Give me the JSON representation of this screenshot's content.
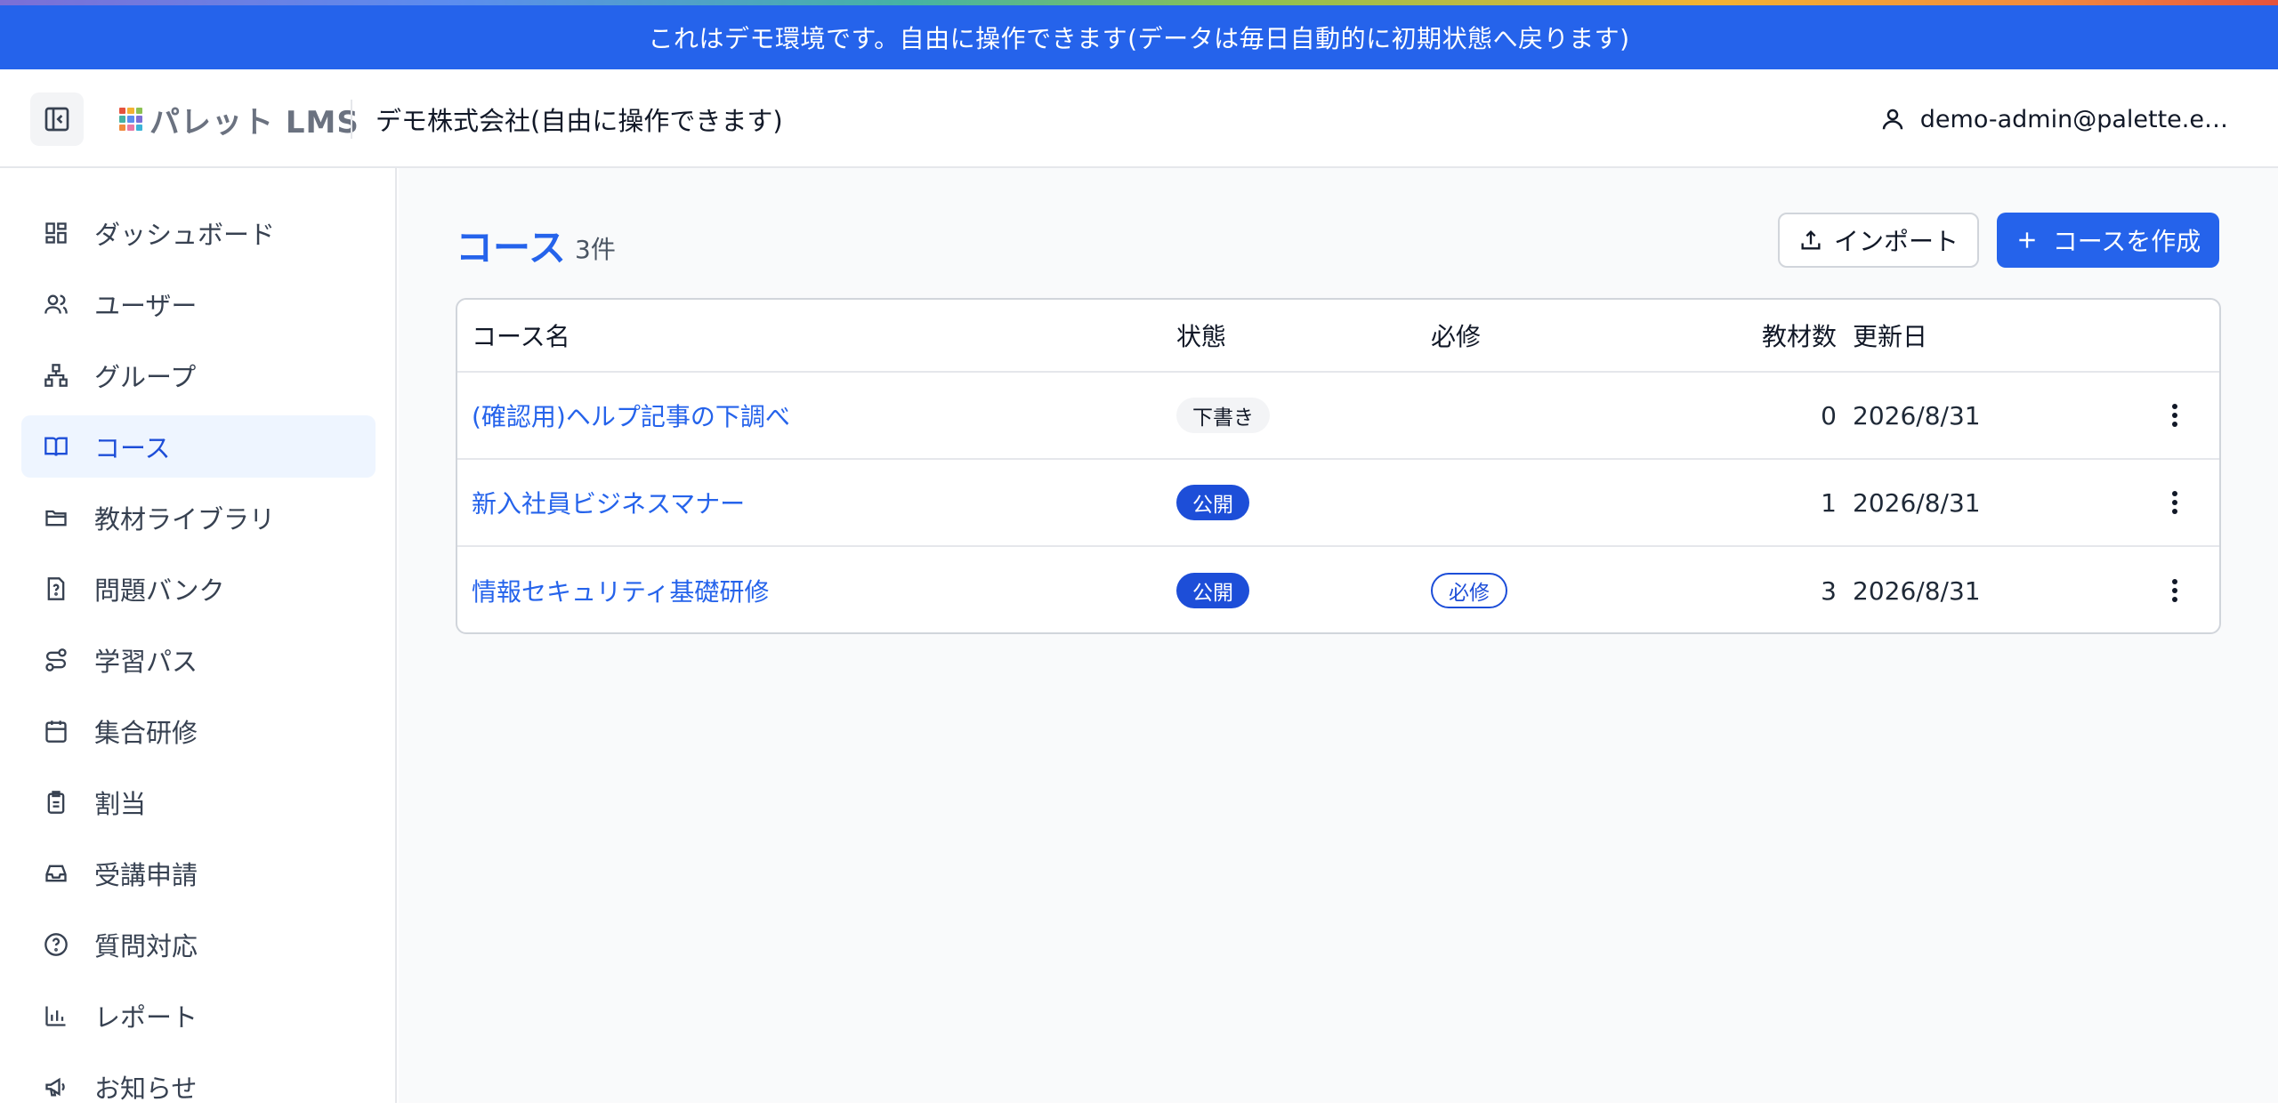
{
  "banner": {
    "text": "これはデモ環境です。自由に操作できます(データは毎日自動的に初期状態へ戻ります)"
  },
  "header": {
    "logo_text": "パレット LMS",
    "company": "デモ株式会社(自由に操作できます)",
    "user_email": "demo-admin@palette.e…"
  },
  "sidebar": {
    "items": [
      {
        "label": "ダッシュボード",
        "icon": "dashboard-icon"
      },
      {
        "label": "ユーザー",
        "icon": "users-icon"
      },
      {
        "label": "グループ",
        "icon": "group-icon"
      },
      {
        "label": "コース",
        "icon": "book-icon",
        "active": true
      },
      {
        "label": "教材ライブラリ",
        "icon": "folder-icon"
      },
      {
        "label": "問題バンク",
        "icon": "question-file-icon"
      },
      {
        "label": "学習パス",
        "icon": "route-icon"
      },
      {
        "label": "集合研修",
        "icon": "calendar-icon"
      },
      {
        "label": "割当",
        "icon": "clipboard-icon"
      },
      {
        "label": "受講申請",
        "icon": "inbox-icon"
      },
      {
        "label": "質問対応",
        "icon": "help-circle-icon"
      },
      {
        "label": "レポート",
        "icon": "bar-chart-icon"
      },
      {
        "label": "お知らせ",
        "icon": "megaphone-icon"
      }
    ]
  },
  "main": {
    "title": "コース",
    "count": "3件",
    "import_label": "インポート",
    "create_label": "コースを作成",
    "table": {
      "headers": {
        "name": "コース名",
        "status": "状態",
        "required": "必修",
        "materials": "教材数",
        "updated": "更新日"
      },
      "rows": [
        {
          "name": "(確認用)ヘルプ記事の下調べ",
          "status": "下書き",
          "status_type": "draft",
          "required": "",
          "materials": "0",
          "updated": "2026/8/31"
        },
        {
          "name": "新入社員ビジネスマナー",
          "status": "公開",
          "status_type": "public",
          "required": "",
          "materials": "1",
          "updated": "2026/8/31"
        },
        {
          "name": "情報セキュリティ基礎研修",
          "status": "公開",
          "status_type": "public",
          "required": "必修",
          "materials": "3",
          "updated": "2026/8/31"
        }
      ]
    }
  },
  "colors": {
    "primary": "#2563eb",
    "active_bg": "#eef5ff"
  }
}
